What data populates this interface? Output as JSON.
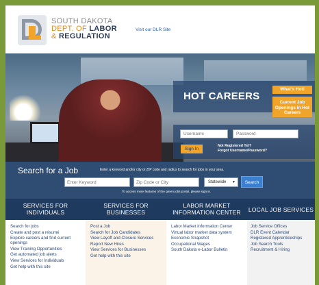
{
  "header": {
    "logo": {
      "line1": "SOUTH DAKOTA",
      "line2_prefix": "DEPT. OF",
      "line2_bold": "LABOR",
      "line3_prefix": "&",
      "line3_bold": "REGULATION"
    },
    "visit_link": "Visit our DLR Site"
  },
  "hero": {
    "hot_title": "HOT CAREERS",
    "whats_hot_label": "What's Hot!",
    "current_openings_label": "Current Job Openings in Hot Careers",
    "login": {
      "username_placeholder": "Username",
      "password_placeholder": "Password",
      "signin_label": "Sign In",
      "not_registered": "Not Registered Yet?",
      "forgot": "Forgot Username/Password?"
    }
  },
  "search": {
    "title": "Search for a Job",
    "hint": "Enter a keyword and/or city or ZIP code and radius to search for jobs in your area.",
    "keyword_placeholder": "Enter Keyword",
    "zip_placeholder": "Zip Code or City",
    "radius_selected": "Statewide",
    "search_label": "Search",
    "note": "To access more features of the green jobs portal, please sign in."
  },
  "services": {
    "individuals": {
      "heading": "SERVICES FOR INDIVIDUALS",
      "items": [
        "Search for jobs",
        "Create and post a résumé",
        "Explore careers and find current openings",
        "View Training Opportunities",
        "Get automated job alerts",
        "View Services for Individuals",
        "Get help with this site"
      ]
    },
    "businesses": {
      "heading": "SERVICES FOR BUSINESSES",
      "items": [
        "Post a Job",
        "Search for Job Candidates",
        "View Layoff and Closure Services",
        "Report New Hires",
        "View Services for Businesses",
        "Get help with this site"
      ]
    },
    "lmic": {
      "heading": "LABOR MARKET INFORMATION CENTER",
      "items": [
        "Labor Market Information Center",
        "Virtual labor market data system",
        "Economic Snapshot",
        "Occupational Wages",
        "South Dakota e-Labor Bulletin"
      ]
    },
    "local": {
      "heading": "LOCAL JOB SERVICES",
      "items": [
        "Job Service Offices",
        "DLR Event Calendar",
        "Registered Apprenticeships",
        "Job Search Tools",
        "Recruitment & Hiring"
      ]
    }
  },
  "colors": {
    "page_border": "#7a9a3a",
    "navy": "#1e3a5e",
    "search_bg": "#2f4d72",
    "orange": "#f0a52a",
    "link": "#2c4a7a"
  }
}
